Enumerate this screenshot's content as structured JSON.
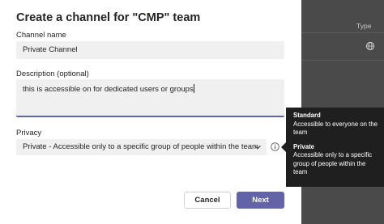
{
  "background": {
    "column_header": "Type"
  },
  "dialog": {
    "title": "Create a channel for \"CMP\" team",
    "channel_name": {
      "label": "Channel name",
      "value": "Private Channel"
    },
    "description": {
      "label": "Description (optional)",
      "value": "this is accessible on for dedicated users or groups"
    },
    "privacy": {
      "label": "Privacy",
      "selected": "Private - Accessible only to a specific group of people within the team"
    },
    "buttons": {
      "cancel": "Cancel",
      "next": "Next"
    }
  },
  "tooltip": {
    "standard_title": "Standard",
    "standard_text": "Accessible to everyone on the team",
    "private_title": "Private",
    "private_text": "Accessible only to a specific group of people within the team"
  },
  "colors": {
    "accent": "#6264a7",
    "tooltip_bg": "#1f1f1f",
    "input_bg": "#f0f0f0"
  }
}
